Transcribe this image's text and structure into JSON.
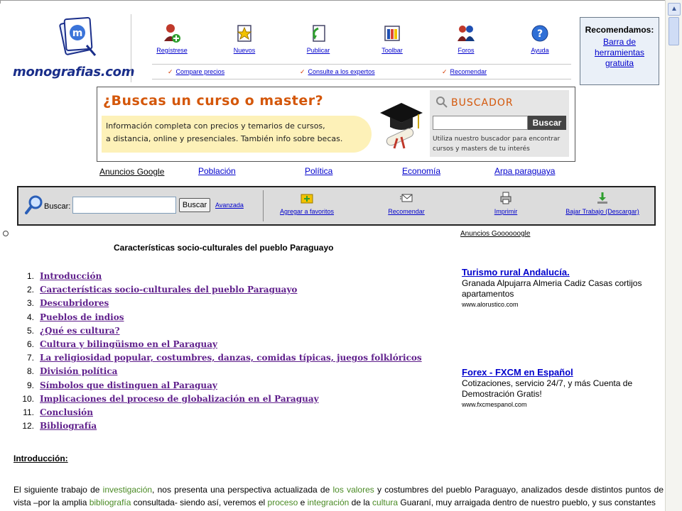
{
  "logo": {
    "wordmark": "monografias.com",
    "letter": "m"
  },
  "nav": {
    "items": [
      {
        "label": "Regístrese",
        "icon": "user-add-icon"
      },
      {
        "label": "Nuevos",
        "icon": "new-star-icon"
      },
      {
        "label": "Publicar",
        "icon": "publish-icon"
      },
      {
        "label": "Toolbar",
        "icon": "toolbar-icon"
      },
      {
        "label": "Foros",
        "icon": "forums-icon"
      },
      {
        "label": "Ayuda",
        "icon": "help-icon"
      }
    ],
    "sub": [
      {
        "label": "Compare precios"
      },
      {
        "label": "Consulte a los expertos"
      },
      {
        "label": "Recomendar"
      }
    ]
  },
  "recommend": {
    "title": "Recomendamos:",
    "link": "Barra de herramientas gratuita"
  },
  "banner": {
    "headline": "¿Buscas un curso o master?",
    "line1": "Información completa con precios y temarios de cursos,",
    "line2": "a distancia, online y presenciales. También info sobre becas.",
    "search_title": "BUSCADOR",
    "search_button": "Buscar",
    "search_note1": "Utiliza nuestro buscador para encontrar",
    "search_note2": "cursos y masters de tu interés"
  },
  "ad_links": {
    "google": "Anuncios Google",
    "links": [
      "Población",
      "Política",
      "Economía",
      "Arpa paraguaya"
    ]
  },
  "toolbar": {
    "search_label": "Buscar:",
    "search_value": "",
    "search_button": "Buscar",
    "advanced": "Avanzada",
    "tools": [
      {
        "label": "Agregar a favoritos",
        "icon": "add-favorite-icon"
      },
      {
        "label": "Recomendar",
        "icon": "email-icon"
      },
      {
        "label": "Imprimir",
        "icon": "print-icon"
      },
      {
        "label": "Bajar Trabajo (Descargar)",
        "icon": "download-icon"
      }
    ]
  },
  "article": {
    "title": "Características socio-culturales del pueblo Paraguayo",
    "toc": [
      {
        "num": "1.",
        "label": "Introducción"
      },
      {
        "num": "2.",
        "label": "Características socio-culturales del pueblo Paraguayo"
      },
      {
        "num": "3.",
        "label": "Descubridores"
      },
      {
        "num": "4.",
        "label": "Pueblos de indios"
      },
      {
        "num": "5.",
        "label": "¿Qué es cultura?"
      },
      {
        "num": "6.",
        "label": "Cultura y bilingüismo en el Paraguay"
      },
      {
        "num": "7.",
        "label": "La religiosidad popular, costumbres, danzas, comidas típicas, juegos folklóricos"
      },
      {
        "num": "8.",
        "label": "División política"
      },
      {
        "num": "9.",
        "label": "Símbolos que distinguen al Paraguay"
      },
      {
        "num": "10.",
        "label": "Implicaciones del proceso de globalización en el Paraguay"
      },
      {
        "num": "11.",
        "label": "Conclusión"
      },
      {
        "num": "12.",
        "label": "Bibliografía"
      }
    ],
    "intro_heading": "Introducción:",
    "para": {
      "s1": "El siguiente trabajo de ",
      "k1": "investigación",
      "s2": ", nos presenta una perspectiva actualizada de ",
      "k2": "los valores",
      "s3": " y costumbres del pueblo Paraguayo, analizados desde distintos puntos de vista –por la amplia ",
      "k3": "bibliografía",
      "s4": " consultada- siendo así, veremos el ",
      "k4": "proceso",
      "s5": " e ",
      "k5": "integración",
      "s6": " de la ",
      "k6": "cultura",
      "s7": " Guaraní, muy arraigada dentro de nuestro pueblo, y sus constantes"
    }
  },
  "side_ads": {
    "heading": "Anuncios Goooooogle",
    "ads": [
      {
        "title": "Turismo rural Andalucía.",
        "desc": "Granada Alpujarra Almeria Cadiz Casas cortijos apartamentos",
        "url": "www.alorustico.com"
      },
      {
        "title": "Forex - FXCM en Español",
        "desc": "Cotizaciones, servicio 24/7, y más Cuenta de Demostración Gratis!",
        "url": "www.fxcmespanol.com"
      }
    ]
  },
  "colors": {
    "link": "#0000cc",
    "visited": "#60208c",
    "accent": "#d4570a",
    "keyword": "#4a8a24"
  }
}
